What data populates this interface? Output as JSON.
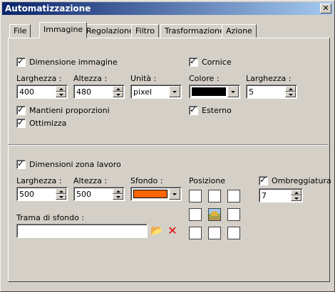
{
  "window": {
    "title": "Automatizzazione"
  },
  "tabs": [
    "File",
    "Immagine",
    "Regolazione",
    "Filtro",
    "Trasformazione",
    "Azione"
  ],
  "image_section": {
    "dimension_label": "Dimensione immagine",
    "width_label": "Larghezza :",
    "width_value": "400",
    "height_label": "Altezza :",
    "height_value": "480",
    "unit_label": "Unità :",
    "unit_value": "pixel",
    "keep_ratio_label": "Mantieni proporzioni",
    "optimize_label": "Ottimizza"
  },
  "frame_section": {
    "frame_label": "Cornice",
    "color_label": "Colore :",
    "color_value": "#000000",
    "width_label": "Larghezza :",
    "width_value": "5",
    "external_label": "Esterno"
  },
  "workspace_section": {
    "dimension_label": "Dimensioni zona lavoro",
    "width_label": "Larghezza :",
    "width_value": "500",
    "height_label": "Altezza :",
    "height_value": "500",
    "background_label": "Sfondo :",
    "background_color": "#ff6600",
    "position_label": "Posizione",
    "shadow_label": "Ombreggiatura",
    "shadow_value": "7",
    "texture_label": "Trama di sfondo :",
    "texture_value": ""
  },
  "icons": {
    "folder": "folder-open-icon",
    "delete": "delete-icon"
  }
}
